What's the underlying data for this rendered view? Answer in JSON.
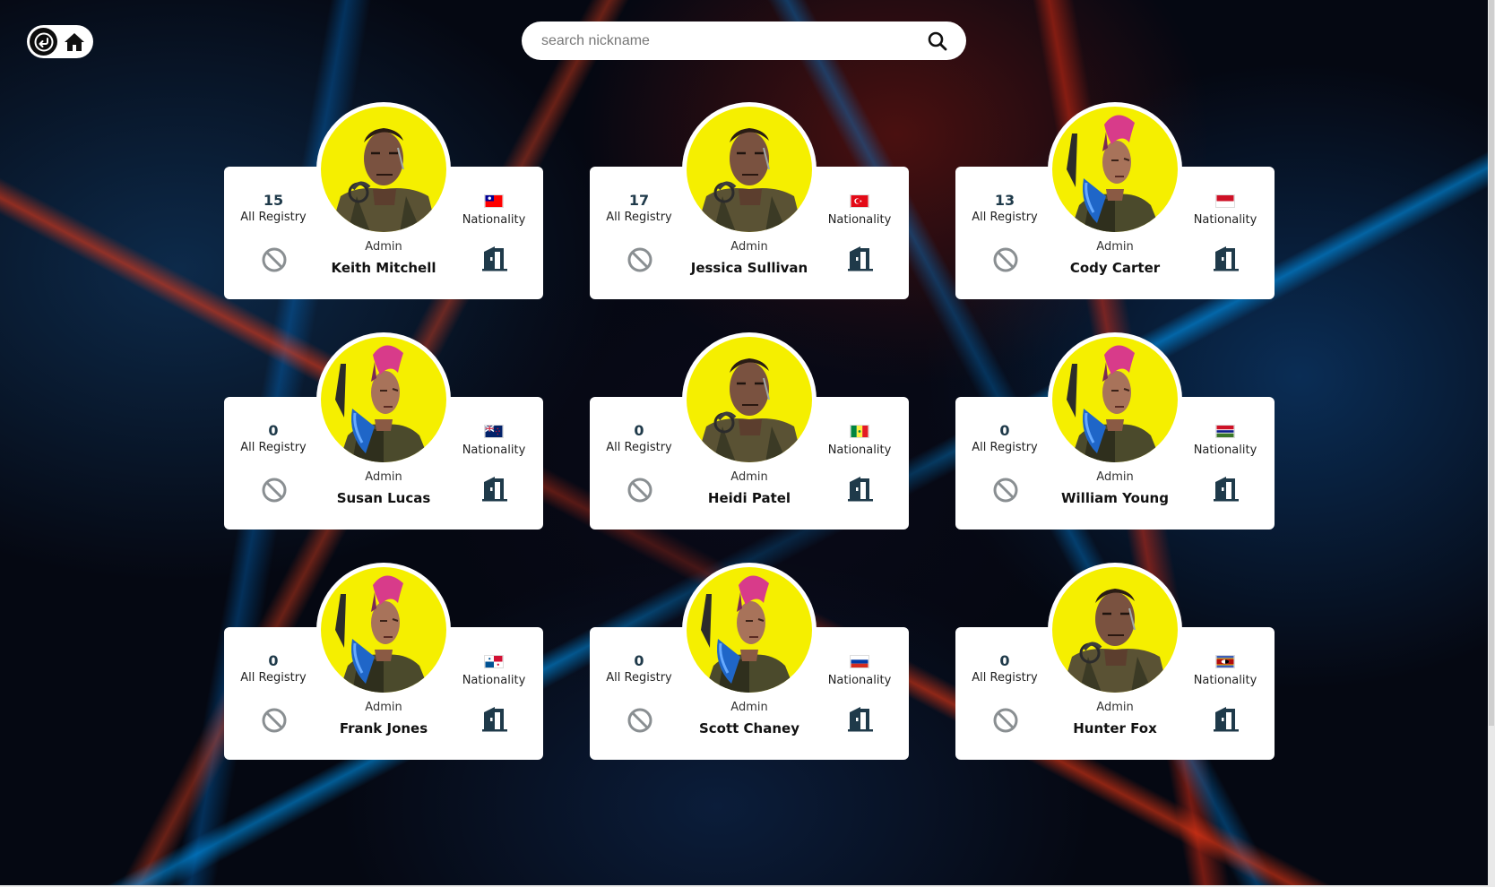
{
  "search": {
    "placeholder": "search nickname"
  },
  "nav": {
    "back_icon": "back-arrow-icon",
    "home_icon": "home-icon"
  },
  "labels": {
    "registry": "All Registry",
    "nationality": "Nationality"
  },
  "colors": {
    "card_bg": "#ffffff",
    "avatar_bg": "#f5ef00",
    "icon": "#1f3a4a"
  },
  "users": [
    {
      "count": "15",
      "role": "Admin",
      "name": "Keith Mitchell",
      "flag": "taiwan",
      "avatar": "male"
    },
    {
      "count": "17",
      "role": "Admin",
      "name": "Jessica Sullivan",
      "flag": "turkey",
      "avatar": "male"
    },
    {
      "count": "13",
      "role": "Admin",
      "name": "Cody Carter",
      "flag": "indonesia",
      "avatar": "female"
    },
    {
      "count": "0",
      "role": "Admin",
      "name": "Susan Lucas",
      "flag": "new-zealand",
      "avatar": "female"
    },
    {
      "count": "0",
      "role": "Admin",
      "name": "Heidi Patel",
      "flag": "senegal",
      "avatar": "male"
    },
    {
      "count": "0",
      "role": "Admin",
      "name": "William Young",
      "flag": "gambia",
      "avatar": "female"
    },
    {
      "count": "0",
      "role": "Admin",
      "name": "Frank Jones",
      "flag": "panama",
      "avatar": "female"
    },
    {
      "count": "0",
      "role": "Admin",
      "name": "Scott Chaney",
      "flag": "russia",
      "avatar": "female"
    },
    {
      "count": "0",
      "role": "Admin",
      "name": "Hunter Fox",
      "flag": "eswatini",
      "avatar": "male"
    }
  ]
}
